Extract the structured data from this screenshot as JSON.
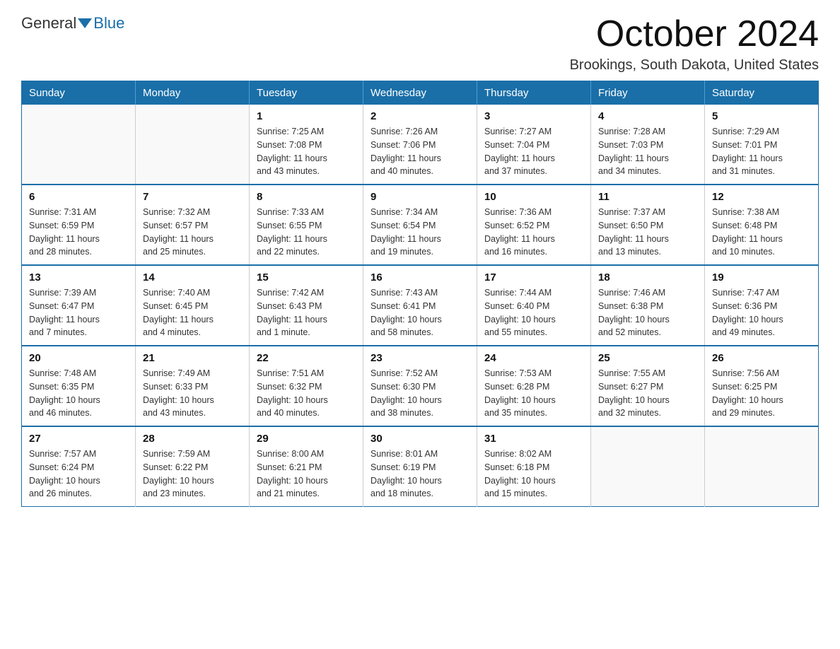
{
  "logo": {
    "general": "General",
    "blue": "Blue"
  },
  "title": "October 2024",
  "location": "Brookings, South Dakota, United States",
  "days_of_week": [
    "Sunday",
    "Monday",
    "Tuesday",
    "Wednesday",
    "Thursday",
    "Friday",
    "Saturday"
  ],
  "weeks": [
    [
      {
        "day": "",
        "info": ""
      },
      {
        "day": "",
        "info": ""
      },
      {
        "day": "1",
        "info": "Sunrise: 7:25 AM\nSunset: 7:08 PM\nDaylight: 11 hours\nand 43 minutes."
      },
      {
        "day": "2",
        "info": "Sunrise: 7:26 AM\nSunset: 7:06 PM\nDaylight: 11 hours\nand 40 minutes."
      },
      {
        "day": "3",
        "info": "Sunrise: 7:27 AM\nSunset: 7:04 PM\nDaylight: 11 hours\nand 37 minutes."
      },
      {
        "day": "4",
        "info": "Sunrise: 7:28 AM\nSunset: 7:03 PM\nDaylight: 11 hours\nand 34 minutes."
      },
      {
        "day": "5",
        "info": "Sunrise: 7:29 AM\nSunset: 7:01 PM\nDaylight: 11 hours\nand 31 minutes."
      }
    ],
    [
      {
        "day": "6",
        "info": "Sunrise: 7:31 AM\nSunset: 6:59 PM\nDaylight: 11 hours\nand 28 minutes."
      },
      {
        "day": "7",
        "info": "Sunrise: 7:32 AM\nSunset: 6:57 PM\nDaylight: 11 hours\nand 25 minutes."
      },
      {
        "day": "8",
        "info": "Sunrise: 7:33 AM\nSunset: 6:55 PM\nDaylight: 11 hours\nand 22 minutes."
      },
      {
        "day": "9",
        "info": "Sunrise: 7:34 AM\nSunset: 6:54 PM\nDaylight: 11 hours\nand 19 minutes."
      },
      {
        "day": "10",
        "info": "Sunrise: 7:36 AM\nSunset: 6:52 PM\nDaylight: 11 hours\nand 16 minutes."
      },
      {
        "day": "11",
        "info": "Sunrise: 7:37 AM\nSunset: 6:50 PM\nDaylight: 11 hours\nand 13 minutes."
      },
      {
        "day": "12",
        "info": "Sunrise: 7:38 AM\nSunset: 6:48 PM\nDaylight: 11 hours\nand 10 minutes."
      }
    ],
    [
      {
        "day": "13",
        "info": "Sunrise: 7:39 AM\nSunset: 6:47 PM\nDaylight: 11 hours\nand 7 minutes."
      },
      {
        "day": "14",
        "info": "Sunrise: 7:40 AM\nSunset: 6:45 PM\nDaylight: 11 hours\nand 4 minutes."
      },
      {
        "day": "15",
        "info": "Sunrise: 7:42 AM\nSunset: 6:43 PM\nDaylight: 11 hours\nand 1 minute."
      },
      {
        "day": "16",
        "info": "Sunrise: 7:43 AM\nSunset: 6:41 PM\nDaylight: 10 hours\nand 58 minutes."
      },
      {
        "day": "17",
        "info": "Sunrise: 7:44 AM\nSunset: 6:40 PM\nDaylight: 10 hours\nand 55 minutes."
      },
      {
        "day": "18",
        "info": "Sunrise: 7:46 AM\nSunset: 6:38 PM\nDaylight: 10 hours\nand 52 minutes."
      },
      {
        "day": "19",
        "info": "Sunrise: 7:47 AM\nSunset: 6:36 PM\nDaylight: 10 hours\nand 49 minutes."
      }
    ],
    [
      {
        "day": "20",
        "info": "Sunrise: 7:48 AM\nSunset: 6:35 PM\nDaylight: 10 hours\nand 46 minutes."
      },
      {
        "day": "21",
        "info": "Sunrise: 7:49 AM\nSunset: 6:33 PM\nDaylight: 10 hours\nand 43 minutes."
      },
      {
        "day": "22",
        "info": "Sunrise: 7:51 AM\nSunset: 6:32 PM\nDaylight: 10 hours\nand 40 minutes."
      },
      {
        "day": "23",
        "info": "Sunrise: 7:52 AM\nSunset: 6:30 PM\nDaylight: 10 hours\nand 38 minutes."
      },
      {
        "day": "24",
        "info": "Sunrise: 7:53 AM\nSunset: 6:28 PM\nDaylight: 10 hours\nand 35 minutes."
      },
      {
        "day": "25",
        "info": "Sunrise: 7:55 AM\nSunset: 6:27 PM\nDaylight: 10 hours\nand 32 minutes."
      },
      {
        "day": "26",
        "info": "Sunrise: 7:56 AM\nSunset: 6:25 PM\nDaylight: 10 hours\nand 29 minutes."
      }
    ],
    [
      {
        "day": "27",
        "info": "Sunrise: 7:57 AM\nSunset: 6:24 PM\nDaylight: 10 hours\nand 26 minutes."
      },
      {
        "day": "28",
        "info": "Sunrise: 7:59 AM\nSunset: 6:22 PM\nDaylight: 10 hours\nand 23 minutes."
      },
      {
        "day": "29",
        "info": "Sunrise: 8:00 AM\nSunset: 6:21 PM\nDaylight: 10 hours\nand 21 minutes."
      },
      {
        "day": "30",
        "info": "Sunrise: 8:01 AM\nSunset: 6:19 PM\nDaylight: 10 hours\nand 18 minutes."
      },
      {
        "day": "31",
        "info": "Sunrise: 8:02 AM\nSunset: 6:18 PM\nDaylight: 10 hours\nand 15 minutes."
      },
      {
        "day": "",
        "info": ""
      },
      {
        "day": "",
        "info": ""
      }
    ]
  ]
}
